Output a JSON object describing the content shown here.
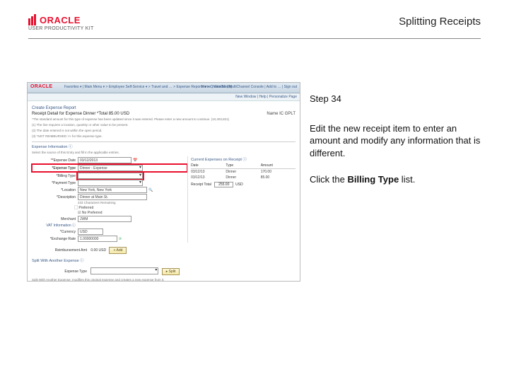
{
  "header": {
    "brand_name": "ORACLE",
    "brand_sub": "USER PRODUCTIVITY KIT",
    "page_title": "Splitting Receipts"
  },
  "instruction": {
    "step_label": "Step 34",
    "body": "Edit the new receipt item to enter an amount and modify any information that is different.",
    "action_prefix": "Click the ",
    "action_bold": "Billing Type",
    "action_suffix": " list."
  },
  "screenshot": {
    "brand": "ORACLE",
    "breadcrumbs": "Favorites ▾  |  Main Menu ▾  >  Employee Self-Service ▾  >  Travel and …  >  Expense Reports ▾  >  Create/Modify",
    "tabs": "Home  |  Worklist  |  MultiChannel Console  |  Add to …  |  Sign out",
    "top_links": "New Window | Help | Personalize Page",
    "section": "Create Expense Report",
    "receipt_title": "Receipt Detail for Expense Dinner   *Total 85.00 USD",
    "report_name": "Name   IC GPLT",
    "notes": [
      "*The standard amount for this type of expense has been updated since it was entered. Please enter a new amount to continue. (10,403,821)",
      "(1) The line requires a location, quantity or other value to be present.",
      "(2) The date entered is not within the open period.",
      "(3) *NOT REIMBURSED >> for this expense type."
    ],
    "ei_label": "Expense Information  ⓘ",
    "ei_hint": "Select the source of this Entry and fill in the applicable entries.",
    "fields": {
      "expense_date": {
        "label": "*Expense Date",
        "value": "03/12/2013"
      },
      "expense_type": {
        "label": "*Expense Type",
        "value": "Dinner - Expense"
      },
      "billing_type": {
        "label": "*Billing Type",
        "value": ""
      },
      "payment_type": {
        "label": "*Payment Type",
        "value": ""
      },
      "location": {
        "label": "*Location",
        "value": "New York, New York"
      },
      "description": {
        "label": "*Description",
        "value": "Dinner at Main St."
      },
      "chars_remaining": "233 Characters Remaining",
      "preferred_merchant": {
        "label": "⃞ Preferred",
        "value": ""
      },
      "non_preferred_merchant": {
        "label": "☑ No Preferred",
        "value": ""
      },
      "merchant": {
        "label": "Merchant",
        "value": "JWM"
      },
      "vat_info": {
        "label": "VAT Information  ⓘ",
        "value": ""
      },
      "currency": {
        "label": "*Currency",
        "value": "USD"
      },
      "exchange_rate": {
        "label": "*Exchange Rate",
        "value": "1.00000000"
      }
    },
    "cer_label": "Current Expenses on Receipt  ⓘ",
    "table": {
      "headers": [
        "Date",
        "Type",
        "Amount"
      ],
      "rows": [
        [
          "03/12/13",
          "Dinner",
          "170.00"
        ],
        [
          "03/12/13",
          "Dinner",
          "85.00"
        ]
      ],
      "receipt_total_label": "Receipt Total",
      "receipt_total_value": "255.00",
      "currency": "USD"
    },
    "reimb_label": "Reimbursement Amt",
    "reimb_value": "0.00   USD",
    "btn_add": "+ Add",
    "split_label": "Split With Another Expense  ⓘ",
    "split_type_label": "Expense Type",
    "btn_split": "▸ Split",
    "foot": "Split With Another Expense: modifies this original expense and creates a new expense from it."
  }
}
